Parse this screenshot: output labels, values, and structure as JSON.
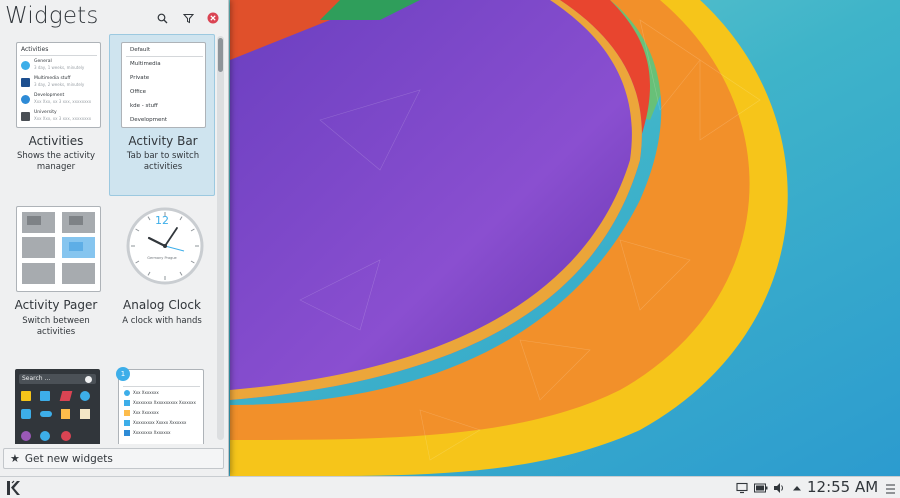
{
  "panel": {
    "title": "Widgets",
    "get_new_label": "Get new widgets"
  },
  "widgets": [
    {
      "title": "Activities",
      "description": "Shows the activity manager",
      "thumb": {
        "header": "Activities",
        "rows": [
          {
            "name": "General",
            "meta": "3 day, 1 weeks, minutely"
          },
          {
            "name": "Multimedia stuff",
            "meta": "3 day, 2 weeks, minutely"
          },
          {
            "name": "Development",
            "meta": "Xxx Xxx, xx 3 xxx, xxxxxxxx"
          },
          {
            "name": "University",
            "meta": "Xxx Xxx, xx 3 xxx, xxxxxxxx"
          }
        ]
      }
    },
    {
      "title": "Activity Bar",
      "description": "Tab bar to switch activities",
      "thumb": {
        "items": [
          "Default",
          "Multimedia",
          "Private",
          "Office",
          "kde - stuff",
          "Development"
        ]
      }
    },
    {
      "title": "Activity Pager",
      "description": "Switch between activities"
    },
    {
      "title": "Analog Clock",
      "description": "A clock with hands",
      "thumb": {
        "number": "12",
        "label": "Germany Prague"
      }
    },
    {
      "title": "",
      "description": "",
      "thumb": {
        "search_placeholder": "Search ..."
      }
    },
    {
      "title": "",
      "description": "",
      "thumb": {
        "badge": "1",
        "items": [
          "Xxx Xxxxxxx",
          "Xxxxxxxx Xxxxxxxxxx Xxxxxxx",
          "Xxx Xxxxxxx",
          "Xxxxxxxxx Xxxxx Xxxxxxx",
          "Xxxxxxxx Xxxxxxx"
        ]
      }
    }
  ],
  "taskbar": {
    "clock": "12:55 AM",
    "icons": [
      "kde-launcher-icon",
      "battery-icon",
      "volume-icon",
      "tray-expand-icon",
      "hamburger-menu-icon"
    ]
  },
  "colors": {
    "panel_bg": "#eff0f1",
    "selection": "#cfe4ef",
    "accent": "#3daee9",
    "close_red": "#da4453",
    "text": "#31363b"
  }
}
